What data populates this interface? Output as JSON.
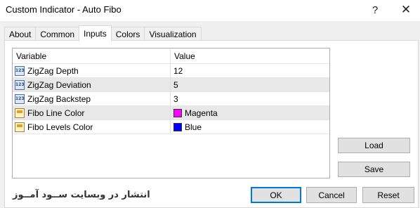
{
  "window": {
    "title": "Custom Indicator - Auto Fibo",
    "help_glyph": "?",
    "close_glyph": "✕"
  },
  "tabs": [
    {
      "label": "About"
    },
    {
      "label": "Common"
    },
    {
      "label": "Inputs"
    },
    {
      "label": "Colors"
    },
    {
      "label": "Visualization"
    }
  ],
  "active_tab": "Inputs",
  "table": {
    "headers": {
      "variable": "Variable",
      "value": "Value"
    },
    "rows": [
      {
        "icon": "number-icon",
        "variable": "ZigZag Depth",
        "value": "12"
      },
      {
        "icon": "number-icon",
        "variable": "ZigZag Deviation",
        "value": "5"
      },
      {
        "icon": "number-icon",
        "variable": "ZigZag Backstep",
        "value": "3"
      },
      {
        "icon": "color-icon",
        "variable": "Fibo Line Color",
        "value": "Magenta",
        "swatch": "#ff00ff"
      },
      {
        "icon": "color-icon",
        "variable": "Fibo Levels Color",
        "value": "Blue",
        "swatch": "#0000ff"
      }
    ]
  },
  "buttons": {
    "load": "Load",
    "save": "Save",
    "ok": "OK",
    "cancel": "Cancel",
    "reset": "Reset"
  },
  "watermark": "انتشار در وبسایت ســود آمــوز",
  "colors": {
    "accent": "#0078d7",
    "magenta": "#ff00ff",
    "blue": "#0000ff"
  }
}
